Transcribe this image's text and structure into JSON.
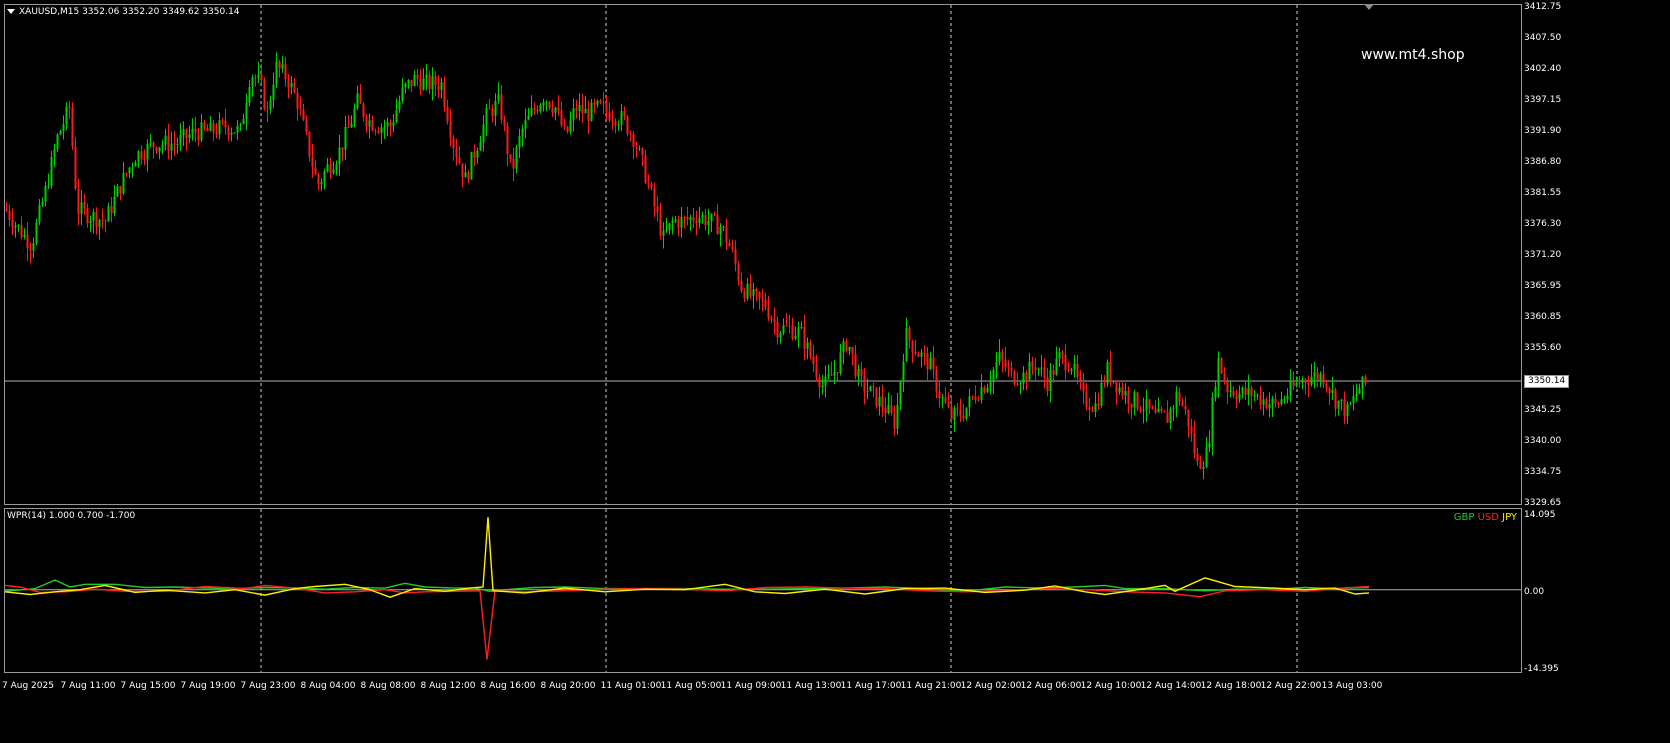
{
  "symbol_header": "XAUUSD,M15  3352.06 3352.20 3349.62 3350.14",
  "watermark": "www.mt4.shop",
  "current_price_label": "3350.14",
  "price_axis": [
    "3412.75",
    "3407.50",
    "3402.40",
    "3397.15",
    "3391.90",
    "3386.80",
    "3381.55",
    "3376.30",
    "3371.20",
    "3365.95",
    "3360.85",
    "3355.60",
    "3350.14",
    "3345.25",
    "3340.00",
    "3334.75",
    "3329.65"
  ],
  "time_axis": [
    "7 Aug 2025",
    "7 Aug 11:00",
    "7 Aug 15:00",
    "7 Aug 19:00",
    "7 Aug 23:00",
    "8 Aug 04:00",
    "8 Aug 08:00",
    "8 Aug 12:00",
    "8 Aug 16:00",
    "8 Aug 20:00",
    "11 Aug 01:00",
    "11 Aug 05:00",
    "11 Aug 09:00",
    "11 Aug 13:00",
    "11 Aug 17:00",
    "11 Aug 21:00",
    "12 Aug 02:00",
    "12 Aug 06:00",
    "12 Aug 10:00",
    "12 Aug 14:00",
    "12 Aug 18:00",
    "12 Aug 22:00",
    "13 Aug 03:00"
  ],
  "indicator": {
    "title": "WPR(14) 1.000 0.700 -1.700",
    "axis": [
      "14.095",
      "0.00",
      "-14.395"
    ],
    "legend": [
      {
        "label": "GBP",
        "color": "#22cc22"
      },
      {
        "label": "USD",
        "color": "#ff2020"
      },
      {
        "label": "JPY",
        "color": "#ffee00"
      }
    ]
  },
  "colors": {
    "bull": "#00d000",
    "bear": "#ff1a1a",
    "grid": "#c8c8c8",
    "gbp": "#22cc22",
    "usd": "#ff2020",
    "jpy": "#ffee00"
  },
  "price_path": [
    [
      0,
      3379
    ],
    [
      12,
      3376
    ],
    [
      26,
      3373
    ],
    [
      40,
      3382
    ],
    [
      52,
      3391
    ],
    [
      64,
      3396
    ],
    [
      72,
      3379
    ],
    [
      84,
      3378
    ],
    [
      100,
      3377
    ],
    [
      115,
      3383
    ],
    [
      130,
      3388
    ],
    [
      150,
      3390
    ],
    [
      170,
      3390
    ],
    [
      190,
      3392
    ],
    [
      205,
      3392
    ],
    [
      220,
      3393
    ],
    [
      235,
      3392
    ],
    [
      245,
      3402
    ],
    [
      255,
      3400
    ],
    [
      262,
      3395
    ],
    [
      270,
      3403
    ],
    [
      282,
      3401
    ],
    [
      292,
      3397
    ],
    [
      302,
      3390
    ],
    [
      312,
      3383
    ],
    [
      322,
      3386
    ],
    [
      332,
      3388
    ],
    [
      342,
      3392
    ],
    [
      352,
      3397
    ],
    [
      362,
      3394
    ],
    [
      372,
      3393
    ],
    [
      385,
      3393
    ],
    [
      398,
      3399
    ],
    [
      410,
      3401
    ],
    [
      422,
      3400
    ],
    [
      436,
      3400
    ],
    [
      448,
      3390
    ],
    [
      460,
      3384
    ],
    [
      470,
      3389
    ],
    [
      482,
      3395
    ],
    [
      494,
      3397
    ],
    [
      506,
      3385
    ],
    [
      516,
      3392
    ],
    [
      526,
      3395
    ],
    [
      538,
      3398
    ],
    [
      550,
      3396
    ],
    [
      560,
      3391
    ],
    [
      570,
      3396
    ],
    [
      582,
      3395
    ],
    [
      594,
      3396
    ],
    [
      606,
      3395
    ],
    [
      618,
      3394
    ],
    [
      628,
      3391
    ],
    [
      638,
      3386
    ],
    [
      648,
      3380
    ],
    [
      658,
      3374
    ],
    [
      668,
      3377
    ],
    [
      680,
      3377
    ],
    [
      692,
      3378
    ],
    [
      704,
      3377
    ],
    [
      716,
      3376
    ],
    [
      726,
      3372
    ],
    [
      736,
      3366
    ],
    [
      748,
      3364
    ],
    [
      760,
      3363
    ],
    [
      772,
      3359
    ],
    [
      784,
      3359
    ],
    [
      796,
      3358
    ],
    [
      806,
      3354
    ],
    [
      818,
      3349
    ],
    [
      830,
      3352
    ],
    [
      842,
      3357
    ],
    [
      854,
      3350
    ],
    [
      866,
      3348
    ],
    [
      878,
      3346
    ],
    [
      890,
      3343
    ],
    [
      900,
      3358
    ],
    [
      912,
      3355
    ],
    [
      924,
      3353
    ],
    [
      934,
      3348
    ],
    [
      946,
      3344
    ],
    [
      958,
      3345
    ],
    [
      970,
      3348
    ],
    [
      982,
      3350
    ],
    [
      994,
      3354
    ],
    [
      1006,
      3351
    ],
    [
      1018,
      3351
    ],
    [
      1030,
      3353
    ],
    [
      1042,
      3350
    ],
    [
      1054,
      3354
    ],
    [
      1066,
      3353
    ],
    [
      1078,
      3347
    ],
    [
      1090,
      3346
    ],
    [
      1102,
      3352
    ],
    [
      1114,
      3349
    ],
    [
      1126,
      3347
    ],
    [
      1138,
      3346
    ],
    [
      1150,
      3344
    ],
    [
      1162,
      3344
    ],
    [
      1172,
      3348
    ],
    [
      1182,
      3344
    ],
    [
      1192,
      3336
    ],
    [
      1202,
      3338
    ],
    [
      1212,
      3354
    ],
    [
      1222,
      3349
    ],
    [
      1234,
      3348
    ],
    [
      1246,
      3348
    ],
    [
      1258,
      3347
    ],
    [
      1270,
      3346
    ],
    [
      1282,
      3348
    ],
    [
      1294,
      3350
    ],
    [
      1306,
      3351
    ],
    [
      1318,
      3351
    ],
    [
      1330,
      3347
    ],
    [
      1342,
      3345
    ],
    [
      1354,
      3349
    ],
    [
      1364,
      3350
    ]
  ],
  "gbp_path": [
    [
      0,
      -0.3
    ],
    [
      30,
      0.2
    ],
    [
      50,
      1.8
    ],
    [
      65,
      0.5
    ],
    [
      80,
      1.0
    ],
    [
      110,
      1.0
    ],
    [
      140,
      0.4
    ],
    [
      170,
      0.5
    ],
    [
      200,
      0.3
    ],
    [
      230,
      0.2
    ],
    [
      260,
      0.4
    ],
    [
      290,
      0.3
    ],
    [
      320,
      0.1
    ],
    [
      350,
      0.4
    ],
    [
      380,
      0.3
    ],
    [
      400,
      1.2
    ],
    [
      420,
      0.5
    ],
    [
      450,
      0.3
    ],
    [
      470,
      0.3
    ],
    [
      485,
      -0.3
    ],
    [
      500,
      0.0
    ],
    [
      530,
      0.4
    ],
    [
      560,
      0.5
    ],
    [
      600,
      0.2
    ],
    [
      640,
      0.2
    ],
    [
      680,
      0.2
    ],
    [
      720,
      0.1
    ],
    [
      760,
      0.1
    ],
    [
      800,
      0.2
    ],
    [
      840,
      0.3
    ],
    [
      880,
      0.5
    ],
    [
      920,
      0.2
    ],
    [
      960,
      -0.3
    ],
    [
      1000,
      0.5
    ],
    [
      1040,
      0.3
    ],
    [
      1080,
      0.6
    ],
    [
      1100,
      0.8
    ],
    [
      1120,
      0.2
    ],
    [
      1160,
      0.2
    ],
    [
      1200,
      -0.2
    ],
    [
      1230,
      0.1
    ],
    [
      1270,
      0.1
    ],
    [
      1300,
      0.4
    ],
    [
      1330,
      0.2
    ],
    [
      1364,
      0.4
    ]
  ],
  "usd_path": [
    [
      0,
      0.8
    ],
    [
      15,
      0.5
    ],
    [
      35,
      -0.5
    ],
    [
      60,
      -0.4
    ],
    [
      90,
      0.1
    ],
    [
      120,
      -0.3
    ],
    [
      160,
      -0.3
    ],
    [
      200,
      0.6
    ],
    [
      240,
      0.2
    ],
    [
      260,
      0.8
    ],
    [
      290,
      0.3
    ],
    [
      320,
      -0.6
    ],
    [
      350,
      -0.4
    ],
    [
      380,
      0.0
    ],
    [
      400,
      -0.6
    ],
    [
      420,
      -0.4
    ],
    [
      450,
      -0.3
    ],
    [
      475,
      -0.2
    ],
    [
      482,
      -13.0
    ],
    [
      490,
      -0.2
    ],
    [
      520,
      -0.4
    ],
    [
      560,
      -0.2
    ],
    [
      600,
      0.1
    ],
    [
      640,
      0.2
    ],
    [
      680,
      0.1
    ],
    [
      720,
      -0.2
    ],
    [
      760,
      0.4
    ],
    [
      800,
      0.5
    ],
    [
      840,
      0.3
    ],
    [
      880,
      0.2
    ],
    [
      920,
      -0.2
    ],
    [
      960,
      -0.4
    ],
    [
      1000,
      -0.2
    ],
    [
      1040,
      0.2
    ],
    [
      1080,
      0.0
    ],
    [
      1120,
      -0.4
    ],
    [
      1160,
      -0.6
    ],
    [
      1195,
      -1.3
    ],
    [
      1220,
      -0.2
    ],
    [
      1260,
      0.0
    ],
    [
      1300,
      -0.3
    ],
    [
      1330,
      0.2
    ],
    [
      1364,
      0.6
    ]
  ],
  "jpy_path": [
    [
      0,
      -0.4
    ],
    [
      25,
      -0.9
    ],
    [
      50,
      -0.4
    ],
    [
      75,
      0.0
    ],
    [
      100,
      0.8
    ],
    [
      130,
      -0.5
    ],
    [
      160,
      -0.1
    ],
    [
      200,
      -0.6
    ],
    [
      230,
      0.0
    ],
    [
      260,
      -1.0
    ],
    [
      290,
      0.2
    ],
    [
      310,
      0.6
    ],
    [
      340,
      1.0
    ],
    [
      365,
      0.0
    ],
    [
      385,
      -1.4
    ],
    [
      410,
      0.2
    ],
    [
      440,
      -0.3
    ],
    [
      465,
      0.3
    ],
    [
      478,
      0.5
    ],
    [
      483,
      13.5
    ],
    [
      488,
      -0.2
    ],
    [
      520,
      -0.6
    ],
    [
      560,
      0.3
    ],
    [
      600,
      -0.4
    ],
    [
      640,
      0.1
    ],
    [
      680,
      0.0
    ],
    [
      720,
      1.0
    ],
    [
      750,
      -0.4
    ],
    [
      780,
      -0.7
    ],
    [
      820,
      0.1
    ],
    [
      860,
      -0.8
    ],
    [
      900,
      0.2
    ],
    [
      940,
      0.3
    ],
    [
      980,
      -0.5
    ],
    [
      1020,
      -0.1
    ],
    [
      1050,
      0.7
    ],
    [
      1080,
      -0.4
    ],
    [
      1100,
      -0.9
    ],
    [
      1130,
      -0.1
    ],
    [
      1160,
      0.8
    ],
    [
      1170,
      -0.3
    ],
    [
      1200,
      2.2
    ],
    [
      1230,
      0.6
    ],
    [
      1270,
      0.3
    ],
    [
      1300,
      0.0
    ],
    [
      1330,
      0.3
    ],
    [
      1350,
      -0.8
    ],
    [
      1364,
      -0.6
    ]
  ]
}
